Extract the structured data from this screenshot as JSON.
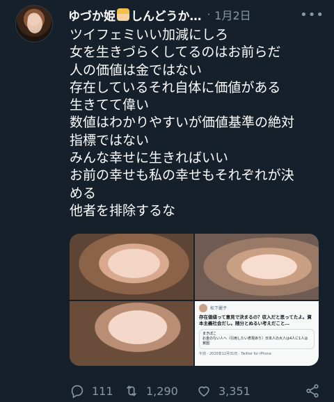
{
  "tweet": {
    "display_name": "ゆづか姫",
    "display_name_suffix": "しんどうか…",
    "separator": "·",
    "timestamp": "1月2日",
    "more_icon": "more-icon",
    "lines": [
      "ツイフェミいい加減にしろ",
      "女を生きづらくしてるのはお前らだ",
      "人の価値は金ではない",
      "存在しているそれ自体に価値がある",
      "生きてて偉い",
      "数値はわかりやすいが価値基準の絶対",
      "指標ではない",
      "みんな幸せに生きればいい",
      "お前の幸せも私の幸せもそれぞれが決",
      "める",
      "他者を排除するな"
    ],
    "media": {
      "embedded_tweet": {
        "name": "松下麗子",
        "text": "存在価値って意見で決まるの？収入だと思ってたよ。資本主義社会だし。随分とぬるい考えだこと…",
        "quoted_name": "まきぽこ",
        "quoted_text": "お金のない人へ（引用したい表現あり）日本人の大人は4人に1人は貧困",
        "meta": "午前 - 2020年12月31日 · Twitter for iPhone"
      }
    },
    "actions": {
      "reply_count": "111",
      "retweet_count": "1,290",
      "like_count": "3,351"
    }
  },
  "colors": {
    "background": "#15202b",
    "text": "#ffffff",
    "secondary": "#8899a6"
  }
}
